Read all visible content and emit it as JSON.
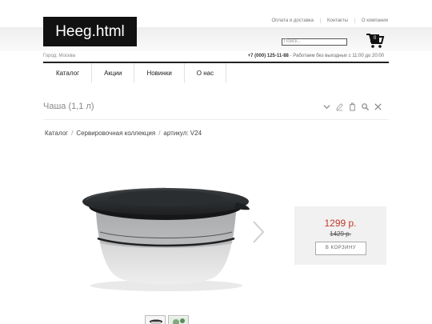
{
  "header": {
    "logo_text": "Heeg.html",
    "links": [
      "Оплата и доставка",
      "Контакты",
      "О компании"
    ],
    "search_placeholder": "Поиск...",
    "cart_count": "0",
    "city": "Город: Москва",
    "phone": "+7 (000) 125-11-88",
    "hours": " - Работаем без выходных с 11:00 до 20:00"
  },
  "nav": {
    "items": [
      "Каталог",
      "Акции",
      "Новинки",
      "О нас"
    ]
  },
  "page": {
    "title": "Чаша (1,1 л)",
    "tools": [
      "chevron-down-icon",
      "edit-icon",
      "copy-icon",
      "search-icon",
      "close-icon"
    ]
  },
  "breadcrumb": {
    "items": [
      "Каталог",
      "Сервировочная коллекция",
      "артикул: V24"
    ]
  },
  "product": {
    "price": "1299 р.",
    "old_price": "1429 р.",
    "buy_label": "В КОРЗИНУ"
  },
  "colors": {
    "accent_price": "#c0392b",
    "dark": "#111111"
  }
}
